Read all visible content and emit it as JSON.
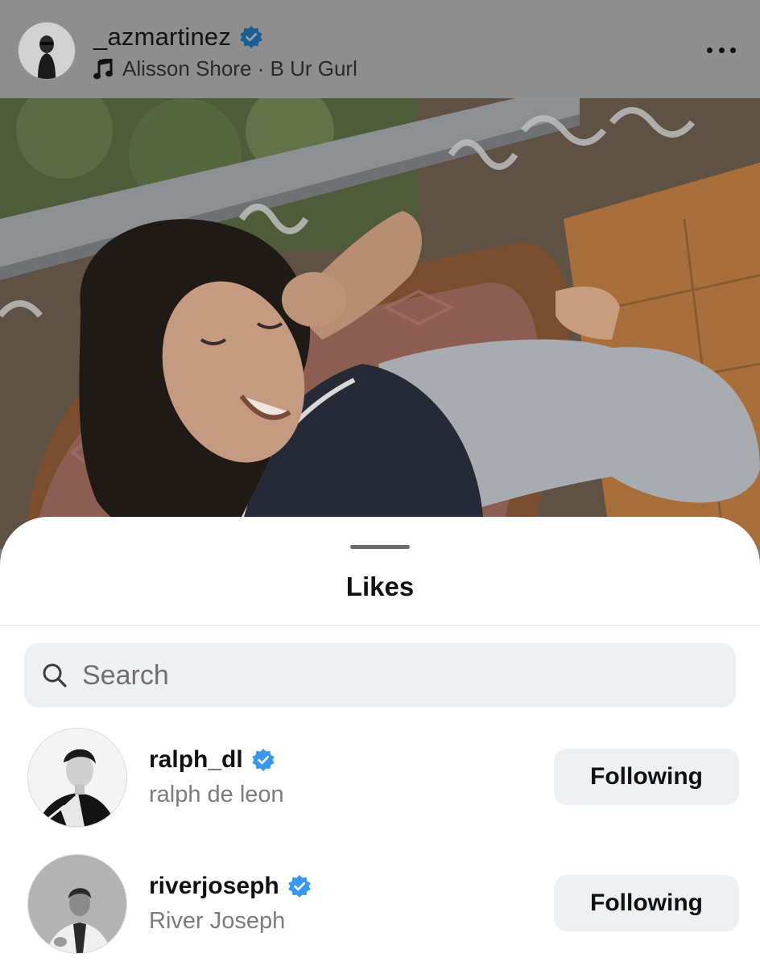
{
  "post": {
    "username": "_azmartinez",
    "music": "Alisson Shore · B Ur Gurl",
    "icons": {
      "verified": "verified-badge-icon",
      "music": "music-note-icon",
      "more": "more-options-icon"
    }
  },
  "likes_sheet": {
    "title": "Likes",
    "search": {
      "placeholder": "Search",
      "value": "",
      "icon": "search-icon"
    },
    "users": [
      {
        "username": "ralph_dl",
        "full_name": "ralph de leon",
        "verified": true,
        "button_label": "Following"
      },
      {
        "username": "riverjoseph",
        "full_name": "River Joseph",
        "verified": true,
        "button_label": "Following"
      }
    ]
  },
  "colors": {
    "verified_blue": "#3897f0",
    "button_bg": "#eff0f2",
    "secondary_text": "#7b7b80"
  }
}
